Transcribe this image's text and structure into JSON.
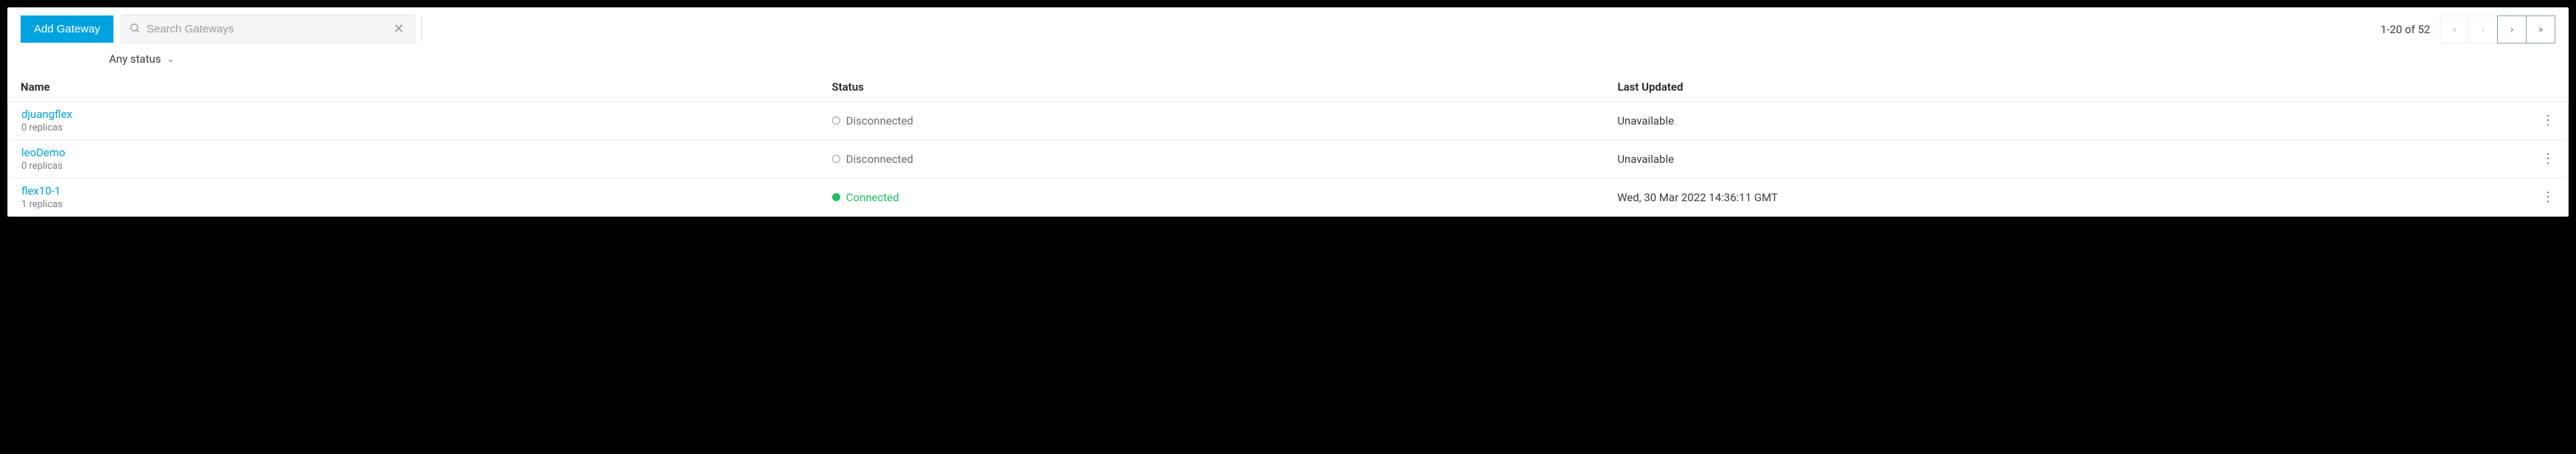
{
  "toolbar": {
    "add_label": "Add Gateway",
    "search_placeholder": "Search Gateways",
    "clear_glyph": "✕"
  },
  "filter": {
    "status_label": "Any status"
  },
  "pagination": {
    "range": "1-20 of 52",
    "first": "«",
    "prev": "‹",
    "next": "›",
    "last": "»"
  },
  "columns": {
    "name": "Name",
    "status": "Status",
    "updated": "Last Updated"
  },
  "rows": [
    {
      "name": "djuangflex",
      "replicas": "0 replicas",
      "status_label": "Disconnected",
      "status_kind": "disconnected",
      "updated": "Unavailable"
    },
    {
      "name": "leoDemo",
      "replicas": "0 replicas",
      "status_label": "Disconnected",
      "status_kind": "disconnected",
      "updated": "Unavailable"
    },
    {
      "name": "flex10-1",
      "replicas": "1 replicas",
      "status_label": "Connected",
      "status_kind": "connected",
      "updated": "Wed, 30 Mar 2022 14:36:11 GMT"
    }
  ],
  "glyphs": {
    "kebab": "⋮",
    "chevron_down": "⌄"
  }
}
